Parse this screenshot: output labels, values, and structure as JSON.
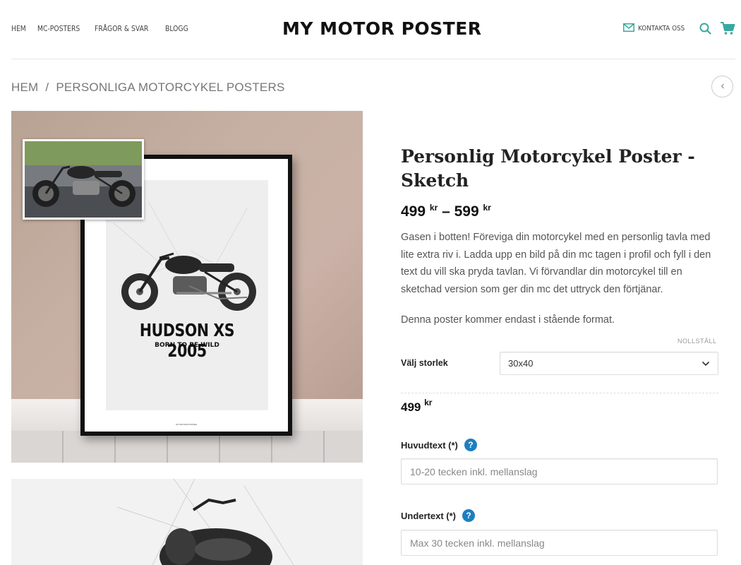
{
  "nav": {
    "items": [
      "HEM",
      "MC-POSTERS",
      "FRÅGOR & SVAR",
      "BLOGG"
    ]
  },
  "logo": "MY MOTOR POSTER",
  "header_right": {
    "contact_label": "KONTAKTA OSS"
  },
  "breadcrumb": {
    "home": "HEM",
    "separator": "/",
    "current": "PERSONLIGA MOTORCYKEL POSTERS"
  },
  "gallery": {
    "poster_title": "HUDSON XS 2005",
    "poster_subtitle": "BORN TO BE WILD",
    "poster_brand": "MY MOTOR POSTER"
  },
  "product": {
    "title": "Personlig Motorcykel Poster - Sketch",
    "price_from": "499",
    "price_to": "599",
    "currency": "kr",
    "price_dash": "–",
    "description": "Gasen i botten! Föreviga din motorcykel med en personlig tavla med lite extra riv i. Ladda upp en bild på din mc tagen i profil och fyll i den text du vill ska pryda tavlan. Vi förvandlar din motorcykel till en sketchad version som ger din mc det uttryck den förtjänar.",
    "format_note": "Denna poster kommer endast i stående format.",
    "reset_label": "NOLLSTÄLL",
    "size_label": "Välj storlek",
    "size_value": "30x40",
    "selected_price": "499",
    "main_text_label": "Huvudtext (*)",
    "main_text_placeholder": "10-20 tecken inkl. mellanslag",
    "sub_text_label": "Undertext (*)",
    "sub_text_placeholder": "Max 30 tecken inkl. mellanslag",
    "help_glyph": "?"
  },
  "colors": {
    "accent": "#3aa8a0",
    "help": "#1d7fc1"
  },
  "icons": [
    "mail-icon",
    "search-icon",
    "cart-icon",
    "chevron-left-icon",
    "chevron-down-icon",
    "help-icon"
  ]
}
